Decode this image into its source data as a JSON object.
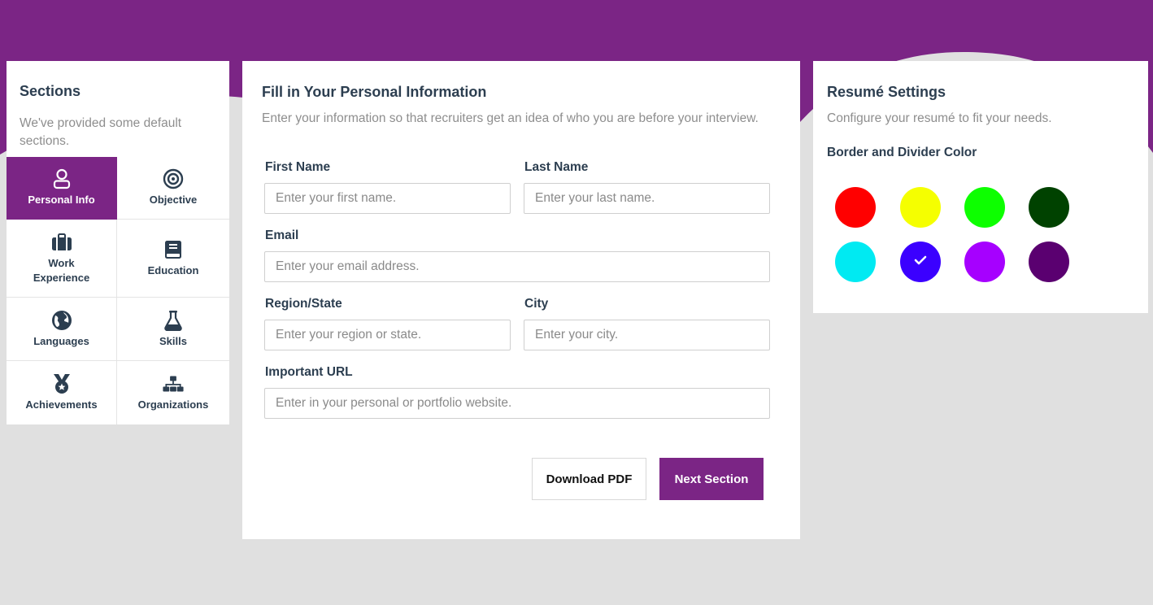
{
  "theme": {
    "accent": "#7b2585",
    "background": "#e0e0e0"
  },
  "sections": {
    "title": "Sections",
    "description": "We've provided some default sections.",
    "items": [
      {
        "label": "Personal Info",
        "icon": "user-icon",
        "active": true
      },
      {
        "label": "Objective",
        "icon": "target-icon",
        "active": false
      },
      {
        "label": "Work Experience",
        "icon": "briefcase-icon",
        "active": false
      },
      {
        "label": "Education",
        "icon": "book-icon",
        "active": false
      },
      {
        "label": "Languages",
        "icon": "globe-icon",
        "active": false
      },
      {
        "label": "Skills",
        "icon": "flask-icon",
        "active": false
      },
      {
        "label": "Achievements",
        "icon": "medal-icon",
        "active": false
      },
      {
        "label": "Organizations",
        "icon": "sitemap-icon",
        "active": false
      }
    ]
  },
  "form": {
    "title": "Fill in Your Personal Information",
    "description": "Enter your information so that recruiters get an idea of who you are before your interview.",
    "first_name": {
      "label": "First Name",
      "placeholder": "Enter your first name.",
      "value": ""
    },
    "last_name": {
      "label": "Last Name",
      "placeholder": "Enter your last name.",
      "value": ""
    },
    "email": {
      "label": "Email",
      "placeholder": "Enter your email address.",
      "value": ""
    },
    "region": {
      "label": "Region/State",
      "placeholder": "Enter your region or state.",
      "value": ""
    },
    "city": {
      "label": "City",
      "placeholder": "Enter your city.",
      "value": ""
    },
    "url": {
      "label": "Important URL",
      "placeholder": "Enter in your personal or portfolio website.",
      "value": ""
    },
    "download_label": "Download PDF",
    "next_label": "Next Section"
  },
  "settings": {
    "title": "Resumé Settings",
    "description": "Configure your resumé to fit your needs.",
    "color_heading": "Border and Divider Color",
    "colors": [
      "#ff0000",
      "#f5ff00",
      "#0dff00",
      "#004200",
      "#00eaf2",
      "#3b00ff",
      "#a600ff",
      "#5a0070"
    ],
    "selected_color": "#3b00ff",
    "selected_icon": "check-icon"
  }
}
